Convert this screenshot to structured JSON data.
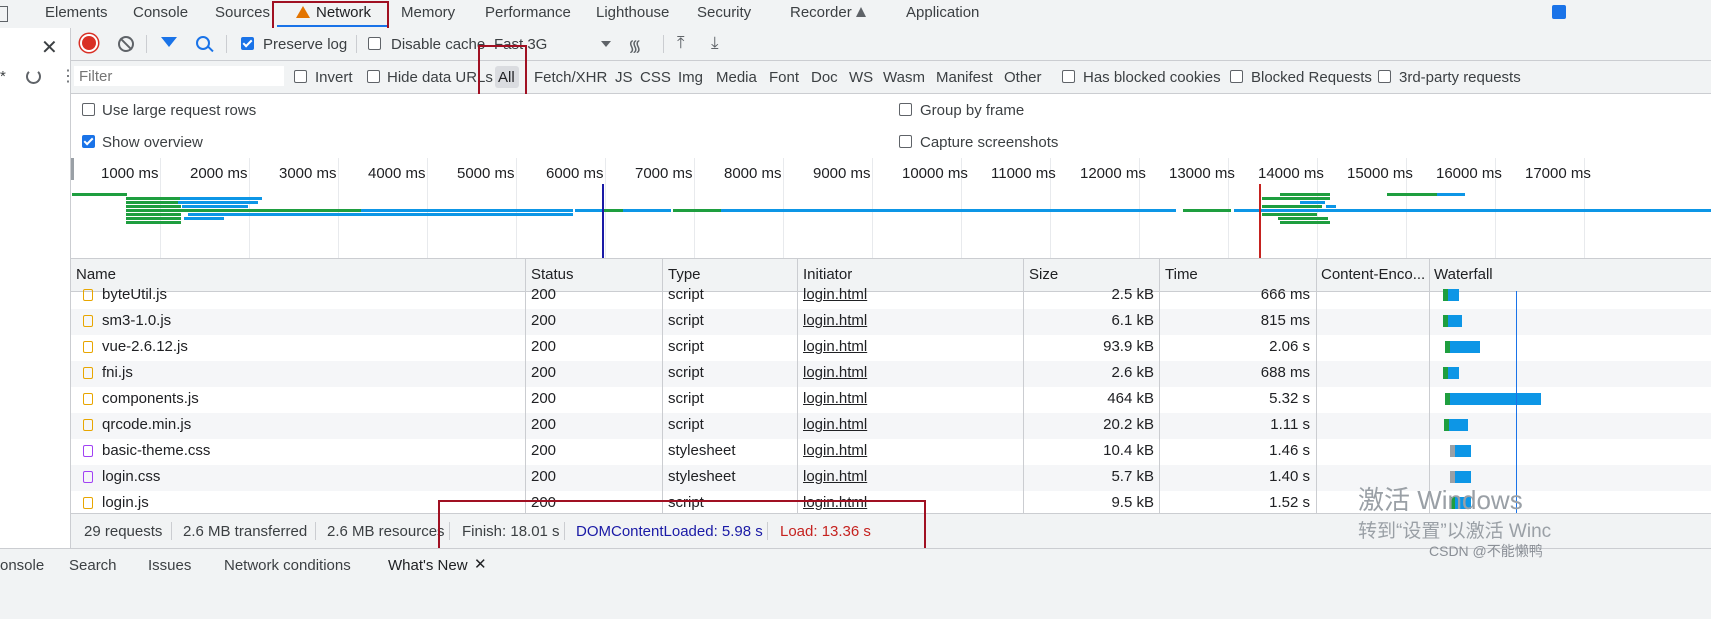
{
  "tabs": [
    "Elements",
    "Console",
    "Sources",
    "Network",
    "Memory",
    "Performance",
    "Lighthouse",
    "Security",
    "Recorder",
    "Application"
  ],
  "toolbar": {
    "preserve_log": "Preserve log",
    "disable_cache": "Disable cache",
    "throttle": "Fast 3G"
  },
  "filter": {
    "placeholder": "Filter",
    "invert": "Invert",
    "hide_data_urls": "Hide data URLs",
    "types": [
      "All",
      "Fetch/XHR",
      "JS",
      "CSS",
      "Img",
      "Media",
      "Font",
      "Doc",
      "WS",
      "Wasm",
      "Manifest",
      "Other"
    ],
    "has_blocked_cookies": "Has blocked cookies",
    "blocked_requests": "Blocked Requests",
    "third_party": "3rd-party requests"
  },
  "options": {
    "large_rows": "Use large request rows",
    "show_overview": "Show overview",
    "group_by_frame": "Group by frame",
    "capture_screenshots": "Capture screenshots"
  },
  "overview_ticks": [
    "1000 ms",
    "2000 ms",
    "3000 ms",
    "4000 ms",
    "5000 ms",
    "6000 ms",
    "7000 ms",
    "8000 ms",
    "9000 ms",
    "10000 ms",
    "11000 ms",
    "12000 ms",
    "13000 ms",
    "14000 ms",
    "15000 ms",
    "16000 ms",
    "17000 ms"
  ],
  "columns": {
    "name": "Name",
    "status": "Status",
    "type": "Type",
    "initiator": "Initiator",
    "size": "Size",
    "time": "Time",
    "content_encoding": "Content-Enco...",
    "waterfall": "Waterfall"
  },
  "rows": [
    {
      "name": "byteUtil.js",
      "status": "200",
      "type": "script",
      "initiator": "login.html",
      "size": "2.5 kB",
      "time": "666 ms",
      "kind": "js",
      "wf": [
        0.1,
        0.04
      ]
    },
    {
      "name": "sm3-1.0.js",
      "status": "200",
      "type": "script",
      "initiator": "login.html",
      "size": "6.1 kB",
      "time": "815 ms",
      "kind": "js",
      "wf": [
        0.1,
        0.05
      ]
    },
    {
      "name": "vue-2.6.12.js",
      "status": "200",
      "type": "script",
      "initiator": "login.html",
      "size": "93.9 kB",
      "time": "2.06 s",
      "kind": "js",
      "wf": [
        0.12,
        0.11
      ]
    },
    {
      "name": "fni.js",
      "status": "200",
      "type": "script",
      "initiator": "login.html",
      "size": "2.6 kB",
      "time": "688 ms",
      "kind": "js",
      "wf": [
        0.1,
        0.04
      ]
    },
    {
      "name": "components.js",
      "status": "200",
      "type": "script",
      "initiator": "login.html",
      "size": "464 kB",
      "time": "5.32 s",
      "kind": "js",
      "wf": [
        0.12,
        0.33
      ]
    },
    {
      "name": "qrcode.min.js",
      "status": "200",
      "type": "script",
      "initiator": "login.html",
      "size": "20.2 kB",
      "time": "1.11 s",
      "kind": "js",
      "wf": [
        0.11,
        0.07
      ]
    },
    {
      "name": "basic-theme.css",
      "status": "200",
      "type": "stylesheet",
      "initiator": "login.html",
      "size": "10.4 kB",
      "time": "1.46 s",
      "kind": "css",
      "wf": [
        0.17,
        0.06
      ]
    },
    {
      "name": "login.css",
      "status": "200",
      "type": "stylesheet",
      "initiator": "login.html",
      "size": "5.7 kB",
      "time": "1.40 s",
      "kind": "css",
      "wf": [
        0.17,
        0.06
      ]
    },
    {
      "name": "login.js",
      "status": "200",
      "type": "script",
      "initiator": "login.html",
      "size": "9.5 kB",
      "time": "1.52 s",
      "kind": "js",
      "wf": [
        0.17,
        0.06
      ]
    }
  ],
  "status": {
    "requests": "29 requests",
    "transferred": "2.6 MB transferred",
    "resources": "2.6 MB resources",
    "finish": "Finish: 18.01 s",
    "dcl": "DOMContentLoaded: 5.98 s",
    "load": "Load: 13.36 s"
  },
  "drawer_tabs": [
    "onsole",
    "Search",
    "Issues",
    "Network conditions",
    "What's New"
  ],
  "watermark": {
    "line1": "激活 Windows",
    "line2": "转到“设置”以激活 Winc",
    "credit": "CSDN @不能懒鸭"
  },
  "colors": {
    "accent": "#1a73e8",
    "dcl": "#1a1aa6",
    "load": "#c5221f",
    "highlight": "#a01022",
    "green": "#1e9e3f",
    "blue": "#0d96e6"
  }
}
